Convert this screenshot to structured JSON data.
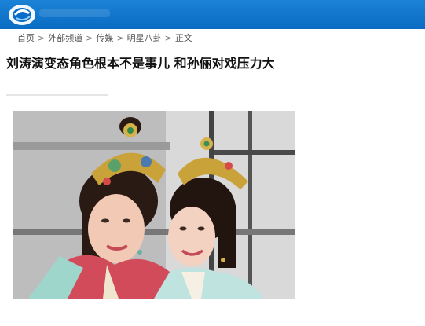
{
  "breadcrumb": {
    "items": [
      "首页",
      "外部频道",
      "传媒",
      "明星八卦",
      "正文"
    ],
    "separator": ">"
  },
  "article": {
    "title": "刘涛演变态角色根本不是事儿 和孙俪对戏压力大"
  },
  "colors": {
    "header_blue": "#0a6cc4",
    "text_dark": "#111111",
    "breadcrumb_gray": "#555555"
  },
  "icons": {
    "logo": "site-logo-icon"
  }
}
